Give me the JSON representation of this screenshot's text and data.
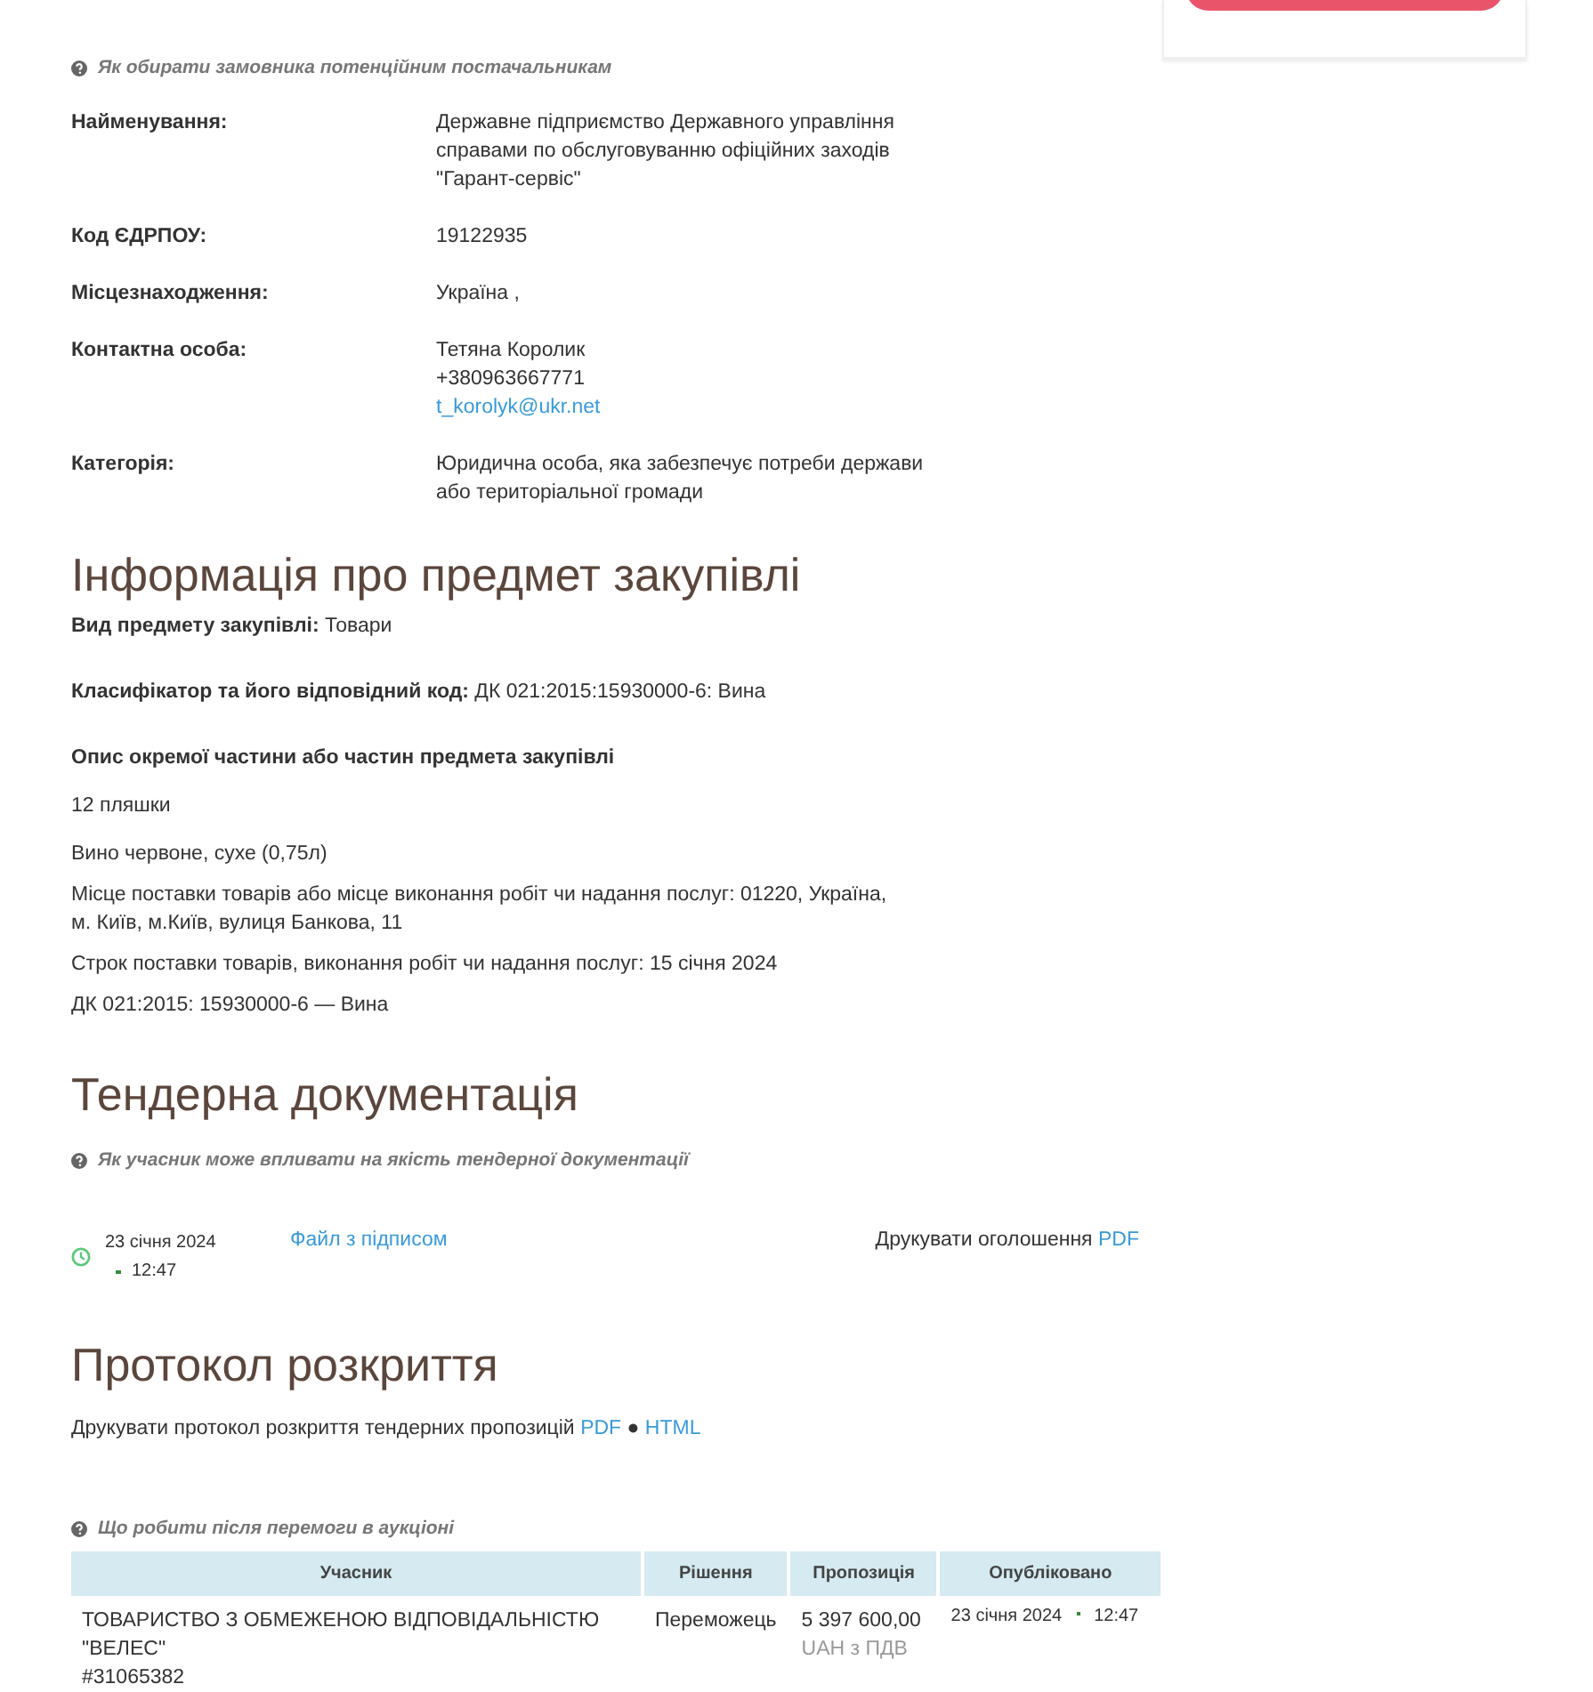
{
  "customer": {
    "hint": "Як обирати замовника потенційним постачальникам",
    "fields": [
      {
        "label": "Найменування:",
        "lines": [
          {
            "kind": "text",
            "text": "Державне підприємство Державного управління справами по обслуговуванню офіційних заходів \"Гарант-сервіс\""
          }
        ]
      },
      {
        "label": "Код ЄДРПОУ:",
        "lines": [
          {
            "kind": "text",
            "text": "19122935"
          }
        ]
      },
      {
        "label": "Місцезнаходження:",
        "lines": [
          {
            "kind": "text",
            "text": "Україна ,"
          }
        ]
      },
      {
        "label": "Контактна особа:",
        "lines": [
          {
            "kind": "text",
            "text": "Тетяна Королик"
          },
          {
            "kind": "text",
            "text": "+380963667771"
          },
          {
            "kind": "link",
            "text": "t_korolyk@ukr.net"
          }
        ]
      },
      {
        "label": "Категорія:",
        "lines": [
          {
            "kind": "text",
            "text": "Юридична особа, яка забезпечує потреби держави або територіальної громади"
          }
        ]
      }
    ]
  },
  "subject": {
    "title": "Інформація про предмет закупівлі",
    "items": [
      {
        "label": "Вид предмету закупівлі:",
        "value": "Товари"
      },
      {
        "label": "Класифікатор та його відповідний код:",
        "value": "ДК 021:2015:15930000-6: Вина"
      }
    ],
    "description_title": "Опис окремої частини або частин предмета закупівлі",
    "paragraphs": [
      "12 пляшки",
      "Вино червоне, сухе (0,75л)",
      "Місце поставки товарів або місце виконання робіт чи надання послуг: 01220, Україна, м. Київ, м.Київ, вулиця Банкова, 11",
      "Строк поставки товарів, виконання робіт чи надання послуг: 15 січня 2024",
      "ДК 021:2015: 15930000-6 — Вина"
    ]
  },
  "documentation": {
    "title": "Тендерна документація",
    "hint": "Як учасник може впливати на якість тендерної документації",
    "file": {
      "date": "23 січня 2024",
      "time": "12:47",
      "link": "Файл з підписом"
    },
    "print": {
      "text": "Друкувати оголошення",
      "link": "PDF"
    }
  },
  "protocol": {
    "title": "Протокол розкриття",
    "print_text": "Друкувати протокол розкриття тендерних пропозицій",
    "links": [
      "PDF",
      "HTML"
    ],
    "separator": "●",
    "hint": "Що робити після перемоги в аукціоні",
    "table": {
      "columns": [
        "Учасник",
        "Рішення",
        "Пропозиція",
        "Опубліковано"
      ],
      "rows": [
        {
          "participant": "ТОВАРИСТВО З ОБМЕЖЕНОЮ ВІДПОВІДАЛЬНІСТЮ \"ВЕЛЕС\"",
          "code": "#31065382",
          "decision": "Переможець",
          "amount": "5 397 600,00",
          "currency": "UAH з ПДВ",
          "date": "23 січня 2024",
          "time": "12:47"
        }
      ]
    }
  }
}
